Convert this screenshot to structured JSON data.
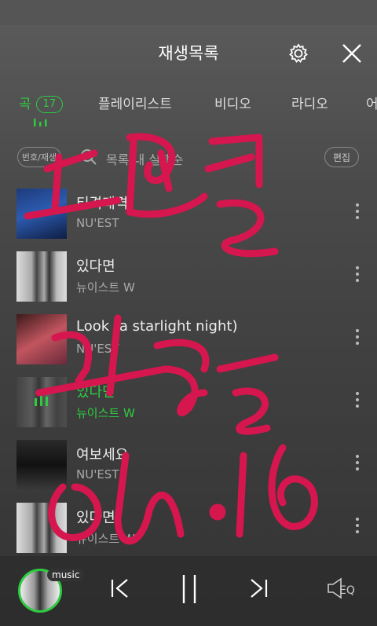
{
  "header": {
    "title": "재생목록"
  },
  "tabs": [
    {
      "label": "곡",
      "badge": "17",
      "active": true
    },
    {
      "label": "플레이리스트"
    },
    {
      "label": "비디오"
    },
    {
      "label": "라디오"
    },
    {
      "label": "어"
    }
  ],
  "toolbar": {
    "sort_label": "번호/재생",
    "search_placeholder": "목록 내 실행순",
    "edit_label": "편집"
  },
  "songs": [
    {
      "title": "티격태격",
      "artist": "NU'EST",
      "playing": false
    },
    {
      "title": "있다면",
      "artist": "뉴이스트 W",
      "playing": false
    },
    {
      "title": "Look (a starlight night)",
      "artist": "NU'EST",
      "playing": false
    },
    {
      "title": "있다면",
      "artist": "뉴이스트 W",
      "playing": true
    },
    {
      "title": "여보세요",
      "artist": "NU'EST",
      "playing": false
    },
    {
      "title": "있다면",
      "artist": "뉴이스트 W",
      "playing": false
    }
  ],
  "player": {
    "badge": "music",
    "eq_label": "EQ"
  },
  "colors": {
    "accent": "#2ecc40",
    "scribble": "#d6164e"
  }
}
